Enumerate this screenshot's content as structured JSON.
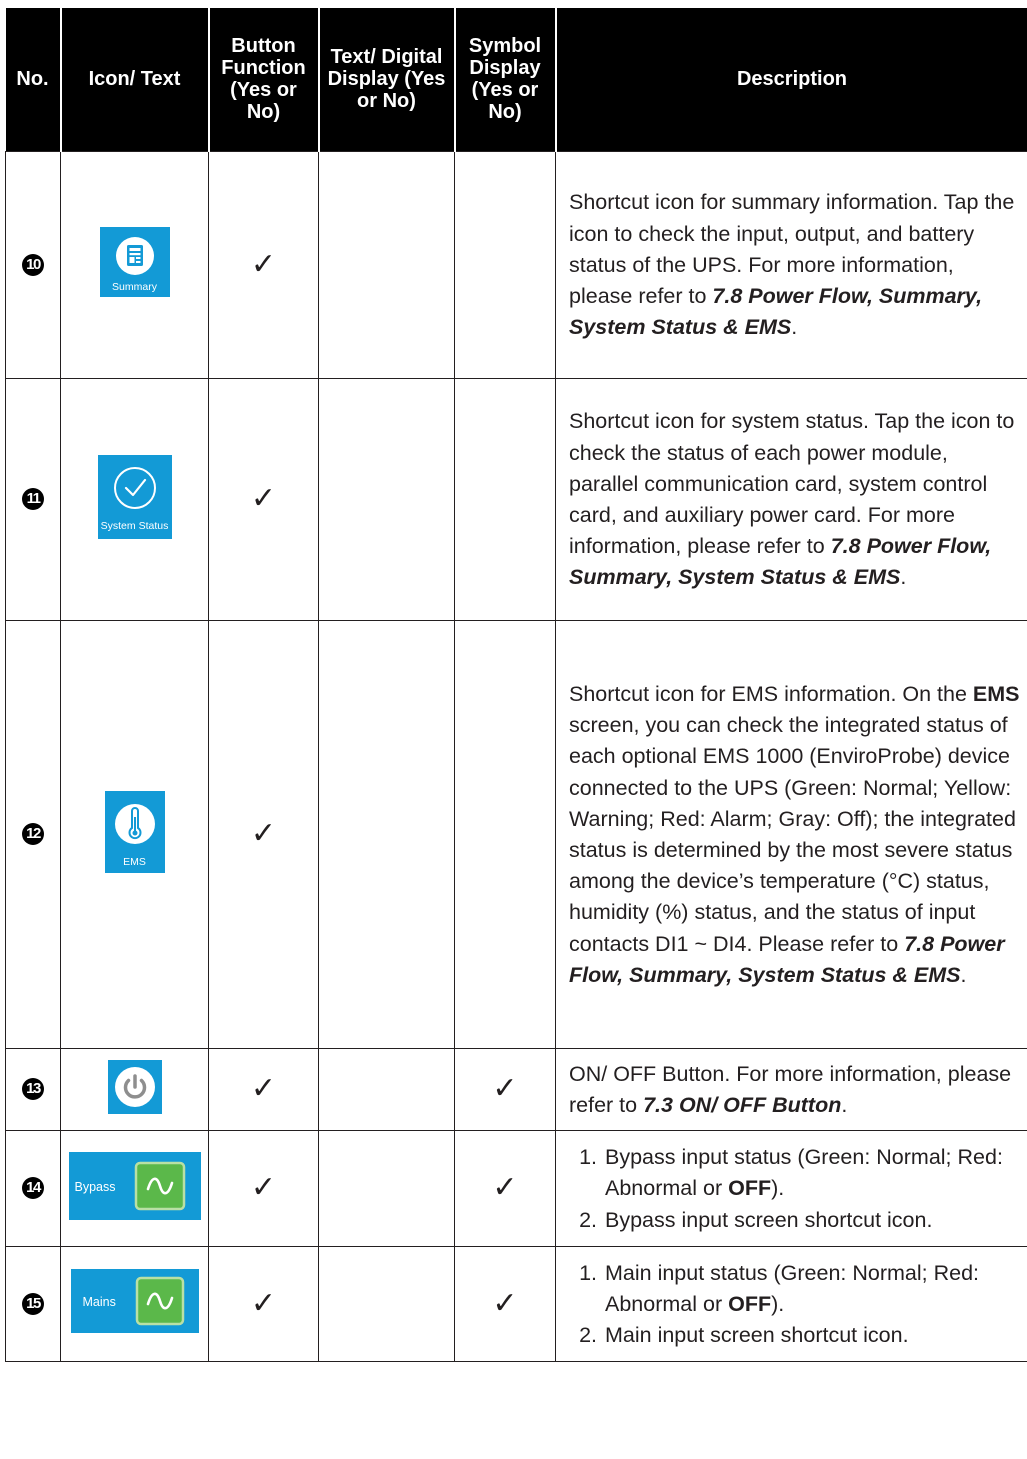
{
  "headers": {
    "no": "No.",
    "icon_text": "Icon/ Text",
    "button_function": "Button Function (Yes or No)",
    "text_digital": "Text/ Digital Display (Yes or No)",
    "symbol_display": "Symbol Display (Yes or No)",
    "description": "Description"
  },
  "check_mark": "✓",
  "rows": [
    {
      "number": "10",
      "icon_label": "Summary",
      "desc_main": "Shortcut icon for summary information. Tap the icon to check the input, output, and battery status of the UPS. For more information, please refer to ",
      "desc_ref": "7.8 Power Flow, Summary, System Status & EMS",
      "desc_end": "."
    },
    {
      "number": "11",
      "icon_label": "System Status",
      "desc_main": "Shortcut icon for system status. Tap the icon to check the status of each power module, parallel communication card, system control card, and auxiliary power card. For more information, please refer to ",
      "desc_ref": "7.8 Power Flow, Summary, System Status & EMS",
      "desc_end": "."
    },
    {
      "number": "12",
      "icon_label": "EMS",
      "desc_a": "Shortcut icon for EMS information. On the ",
      "desc_bold": "EMS",
      "desc_b": " screen, you can check the integrated status of each optional EMS 1000 (EnviroProbe) device connected to the UPS (Green: Normal; Yellow: Warning; Red: Alarm; Gray: Off); the integrated status is determined by the most severe status among the device’s temperature (°C) status, humidity (%) status, and the status of input contacts DI1 ~ DI4. Please refer to ",
      "desc_ref": "7.8 Power Flow, Summary, System Status & EMS",
      "desc_end": "."
    },
    {
      "number": "13",
      "desc_main": "ON/ OFF Button. For more information, please refer to ",
      "desc_ref": "7.3 ON/ OFF Button",
      "desc_end": "."
    },
    {
      "number": "14",
      "icon_label": "Bypass",
      "item1_a": "Bypass input status (Green: Normal; Red: Abnormal or ",
      "item1_bold": "OFF",
      "item1_b": ").",
      "item2": "Bypass input screen shortcut icon."
    },
    {
      "number": "15",
      "icon_label": "Mains",
      "item1_a": "Main input status (Green: Normal; Red: Abnormal or ",
      "item1_bold": "OFF",
      "item1_b": ").",
      "item2": "Main input screen shortcut icon."
    }
  ],
  "colors": {
    "tile_blue": "#139ad6",
    "header_bg": "#000000",
    "sine_green": "#5bb84a"
  }
}
